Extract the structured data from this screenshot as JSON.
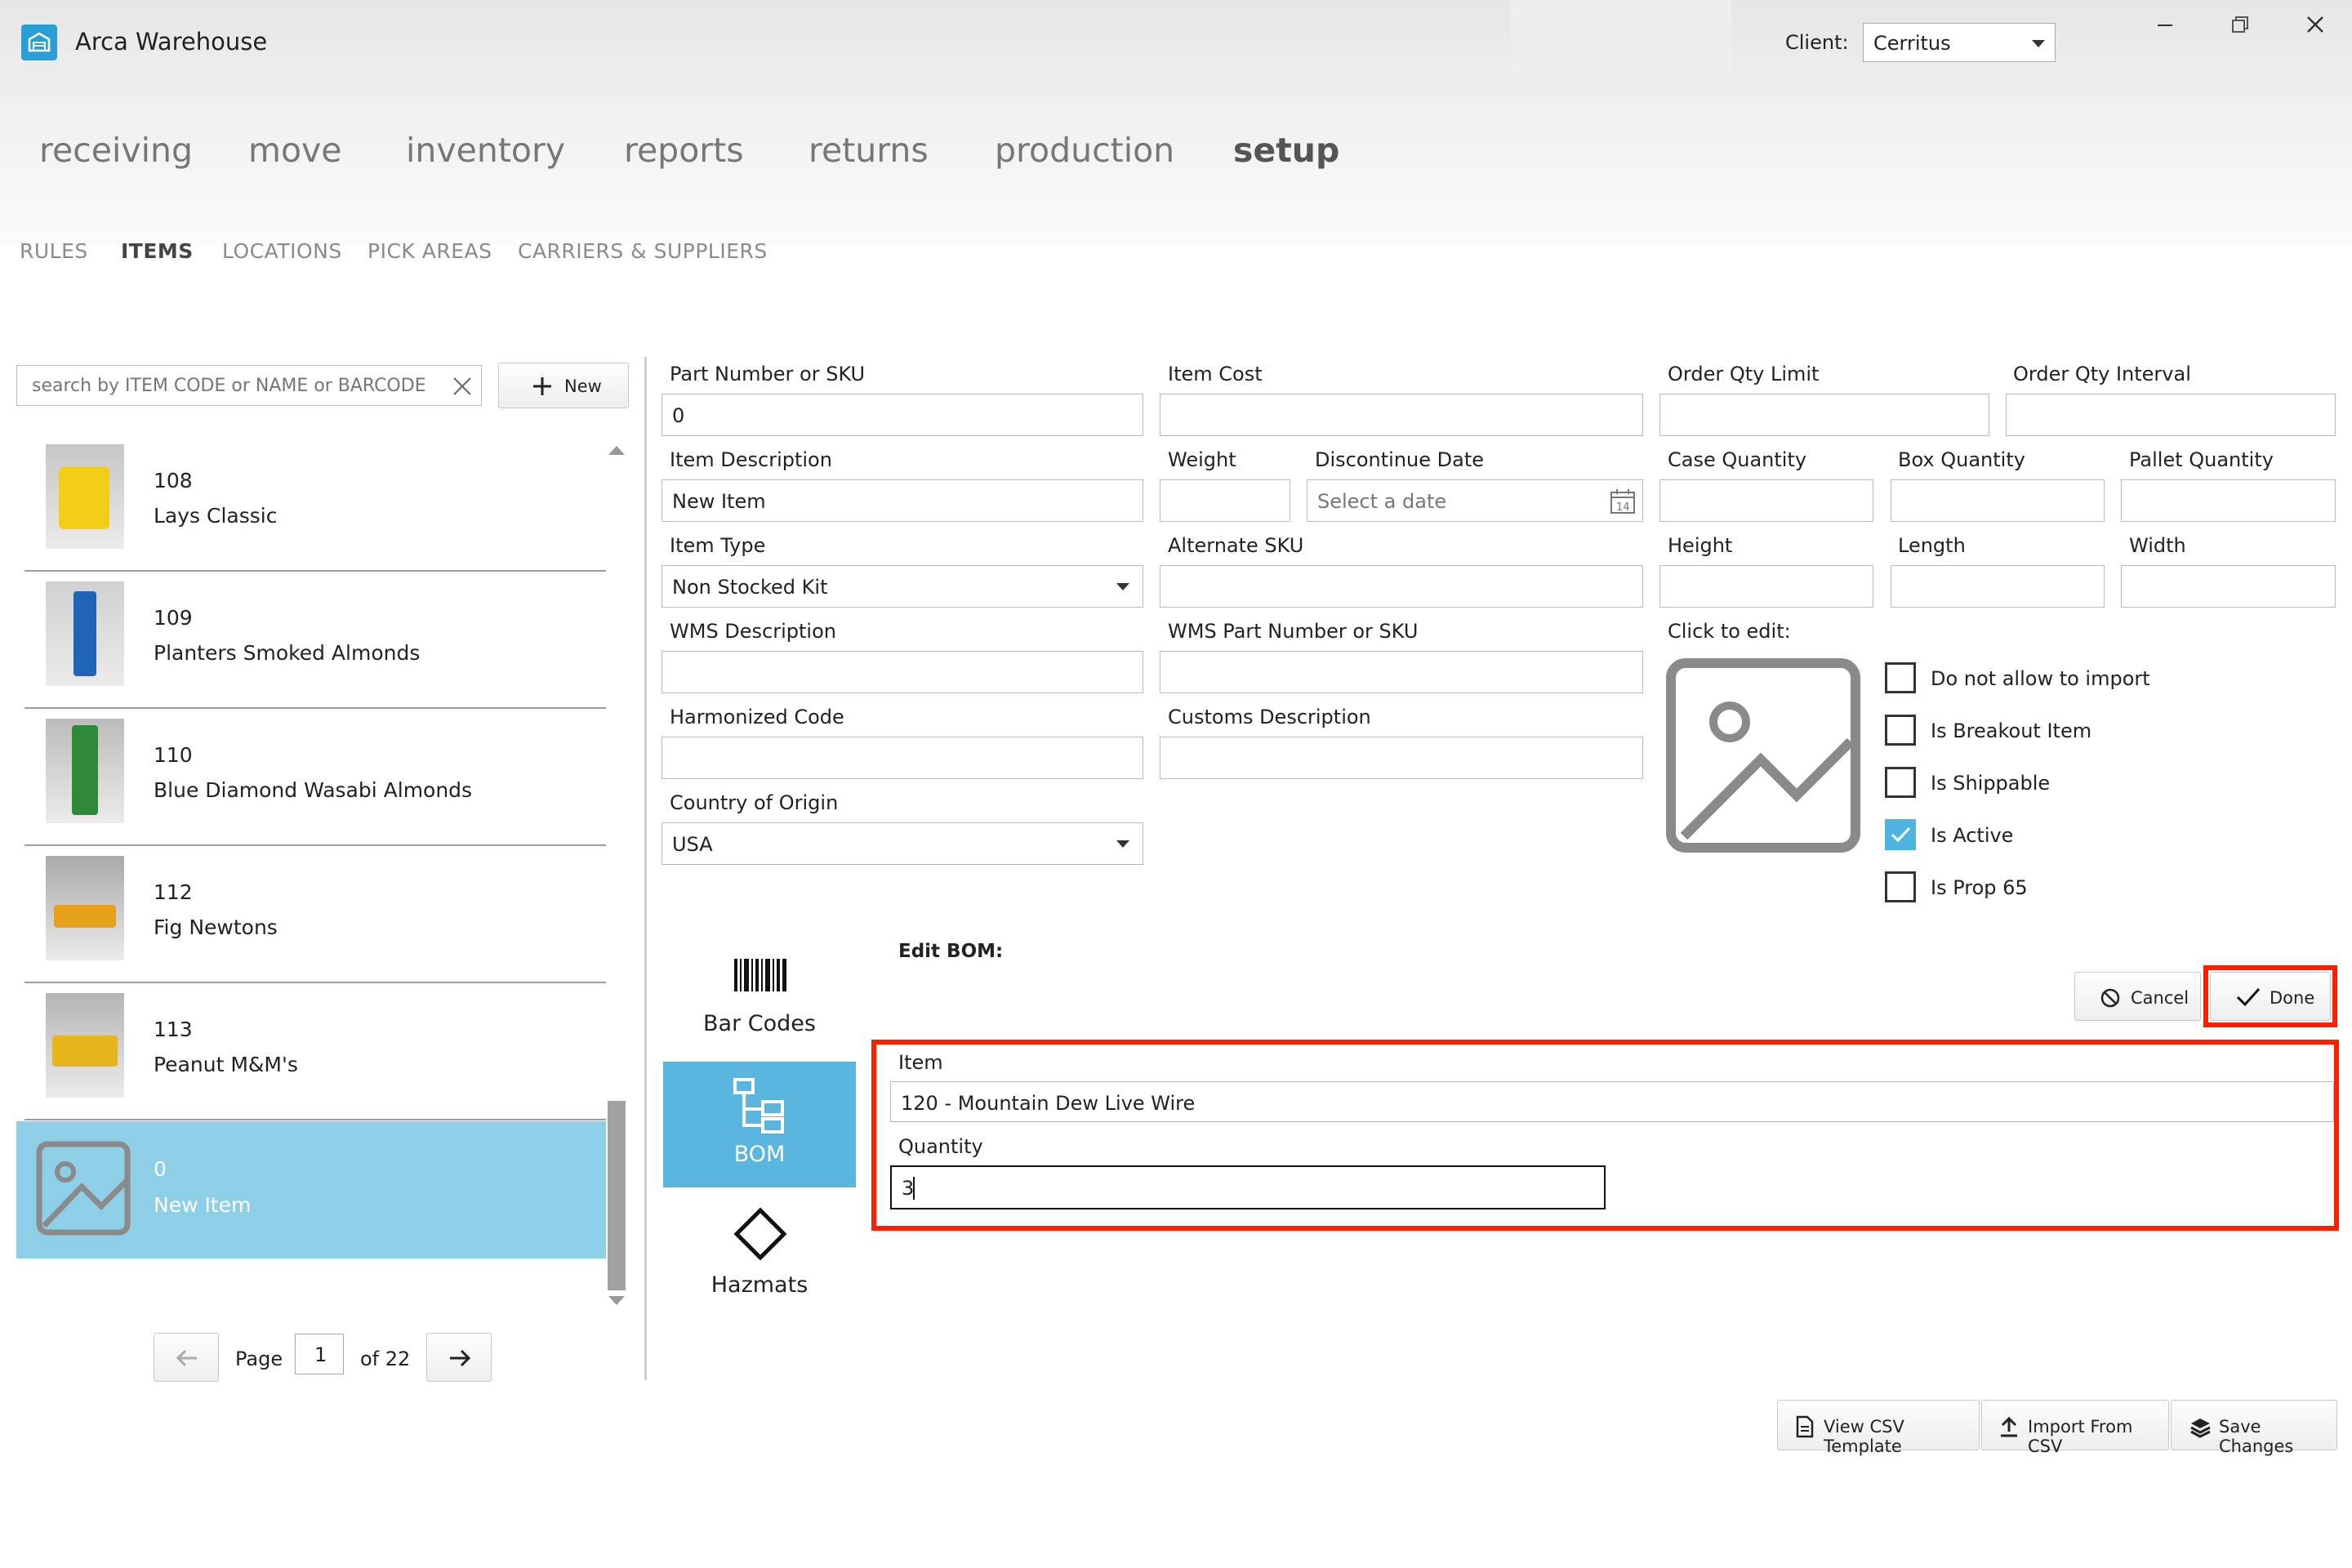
{
  "app": {
    "title": "Arca Warehouse"
  },
  "client": {
    "label": "Client:",
    "value": "Cerritus"
  },
  "main_nav": [
    "receiving",
    "move",
    "inventory",
    "reports",
    "returns",
    "production",
    "setup"
  ],
  "main_nav_active": "setup",
  "sub_nav": [
    "RULES",
    "ITEMS",
    "LOCATIONS",
    "PICK AREAS",
    "CARRIERS & SUPPLIERS"
  ],
  "sub_nav_active": "ITEMS",
  "search": {
    "placeholder": "search by ITEM CODE or NAME or BARCODE"
  },
  "new_button": {
    "label": "New"
  },
  "items": [
    {
      "code": "108",
      "name": "Lays Classic"
    },
    {
      "code": "109",
      "name": "Planters Smoked Almonds"
    },
    {
      "code": "110",
      "name": "Blue Diamond Wasabi Almonds"
    },
    {
      "code": "112",
      "name": "Fig Newtons"
    },
    {
      "code": "113",
      "name": "Peanut M&M's"
    },
    {
      "code": "0",
      "name": "New Item"
    }
  ],
  "pager": {
    "page_label": "Page",
    "page": "1",
    "of_label": "of 22"
  },
  "form": {
    "part_number": {
      "label": "Part Number or SKU",
      "value": "0"
    },
    "item_cost": {
      "label": "Item Cost",
      "value": ""
    },
    "order_qty_limit": {
      "label": "Order Qty Limit",
      "value": ""
    },
    "order_qty_interval": {
      "label": "Order Qty Interval",
      "value": ""
    },
    "item_description": {
      "label": "Item Description",
      "value": "New Item"
    },
    "weight": {
      "label": "Weight",
      "value": ""
    },
    "discontinue_date": {
      "label": "Discontinue Date",
      "placeholder": "Select a date"
    },
    "case_quantity": {
      "label": "Case Quantity",
      "value": ""
    },
    "box_quantity": {
      "label": "Box Quantity",
      "value": ""
    },
    "pallet_quantity": {
      "label": "Pallet Quantity",
      "value": ""
    },
    "item_type": {
      "label": "Item Type",
      "value": "Non Stocked Kit"
    },
    "alternate_sku": {
      "label": "Alternate SKU",
      "value": ""
    },
    "height": {
      "label": "Height",
      "value": ""
    },
    "length": {
      "label": "Length",
      "value": ""
    },
    "width": {
      "label": "Width",
      "value": ""
    },
    "wms_description": {
      "label": "WMS Description",
      "value": ""
    },
    "wms_part_number": {
      "label": "WMS Part Number or SKU",
      "value": ""
    },
    "click_to_edit": "Click to edit:",
    "harmonized_code": {
      "label": "Harmonized Code",
      "value": ""
    },
    "customs_description": {
      "label": "Customs Description",
      "value": ""
    },
    "country_of_origin": {
      "label": "Country of Origin",
      "value": "USA"
    }
  },
  "checkboxes": [
    {
      "label": "Do not allow to import",
      "checked": false
    },
    {
      "label": "Is Breakout Item",
      "checked": false
    },
    {
      "label": "Is Shippable",
      "checked": false
    },
    {
      "label": "Is Active",
      "checked": true
    },
    {
      "label": "Is Prop 65",
      "checked": false
    }
  ],
  "side_tabs": [
    {
      "label": "Bar Codes",
      "icon": "barcode-icon"
    },
    {
      "label": "BOM",
      "icon": "bom-tree-icon",
      "active": true
    },
    {
      "label": "Hazmats",
      "icon": "diamond-icon"
    }
  ],
  "bom": {
    "title": "Edit BOM:",
    "item_label": "Item",
    "item_value": "120 - Mountain Dew Live Wire",
    "quantity_label": "Quantity",
    "quantity_value": "3",
    "cancel_label": "Cancel",
    "done_label": "Done"
  },
  "footer": {
    "view_csv": "View CSV Template",
    "import_csv": "Import From CSV",
    "save": "Save Changes"
  },
  "colors": {
    "accent": "#4eb3de",
    "selected_row": "#8dcfe7",
    "highlight": "#ff1e00"
  }
}
